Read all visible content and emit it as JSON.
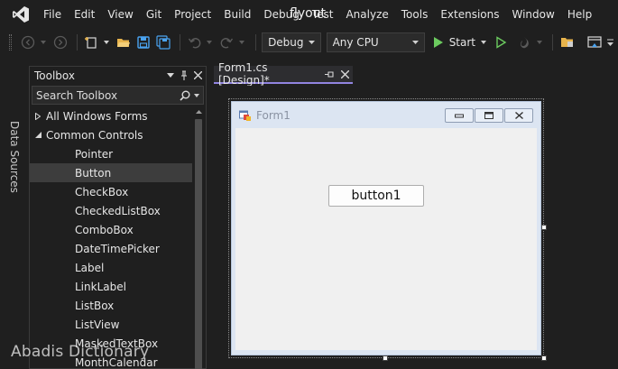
{
  "menubar": {
    "items": [
      "File",
      "Edit",
      "View",
      "Git",
      "Project",
      "Build",
      "Debug",
      "Test",
      "Analyze",
      "Tools",
      "Extensions",
      "Window",
      "Help"
    ],
    "overlay_text": "flyout"
  },
  "toolbar": {
    "configuration": "Debug",
    "platform": "Any CPU",
    "start_label": "Start"
  },
  "side_tab": {
    "label": "Data Sources"
  },
  "toolbox": {
    "title": "Toolbox",
    "search_placeholder": "Search Toolbox",
    "groups": [
      {
        "label": "All Windows Forms",
        "expanded": false
      },
      {
        "label": "Common Controls",
        "expanded": true
      }
    ],
    "items": [
      "Pointer",
      "Button",
      "CheckBox",
      "CheckedListBox",
      "ComboBox",
      "DateTimePicker",
      "Label",
      "LinkLabel",
      "ListBox",
      "ListView",
      "MaskedTextBox",
      "MonthCalendar"
    ],
    "selected_item": "Button"
  },
  "document": {
    "tab_title": "Form1.cs [Design]*"
  },
  "form": {
    "title": "Form1",
    "button_text": "button1"
  },
  "watermark": "Abadis Dictionary",
  "colors": {
    "background": "#1f1f1f",
    "accent": "#9184e0",
    "run_green": "#6ccb5f",
    "save_blue": "#4aa3f0",
    "folder_yellow": "#e8b44c"
  }
}
